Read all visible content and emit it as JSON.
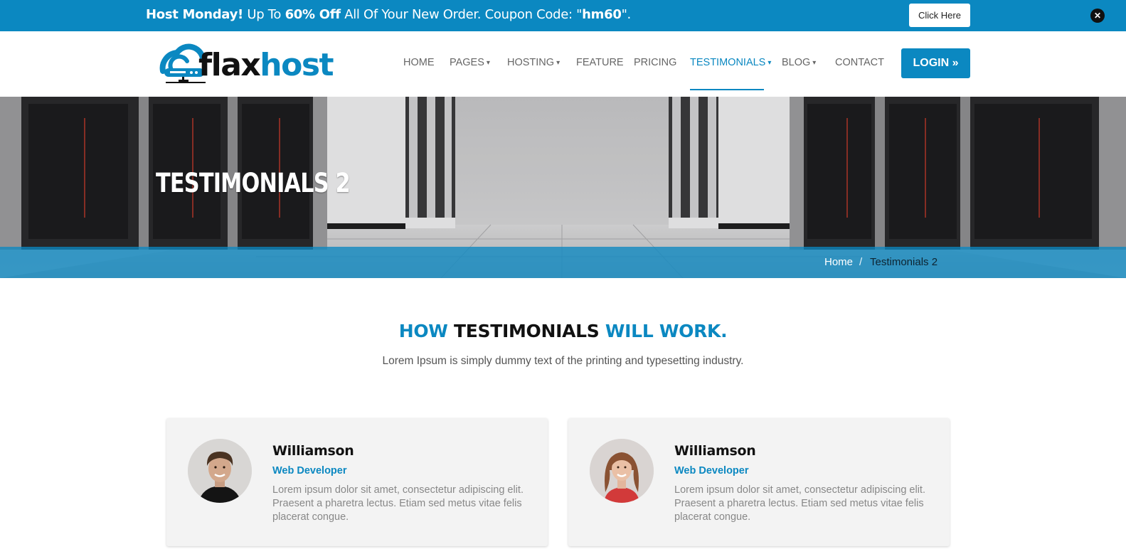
{
  "promo": {
    "lead": "Host Monday!",
    "text1": " Up To ",
    "discount": "60% Off",
    "text2": " All Of Your New Order. Coupon Code: \"",
    "code": "hm60",
    "text3": "\".",
    "button_label": "Click Here",
    "close_icon": "close-icon"
  },
  "logo": {
    "part1": "flax",
    "part2": "host",
    "icon": "cloud-server-icon"
  },
  "nav": {
    "items": [
      {
        "label": "HOME",
        "dropdown": false
      },
      {
        "label": "PAGES",
        "dropdown": true
      },
      {
        "label": "HOSTING",
        "dropdown": true
      },
      {
        "label": "FEATURE",
        "dropdown": false
      },
      {
        "label": "PRICING",
        "dropdown": false
      },
      {
        "label": "TESTIMONIALS",
        "dropdown": true,
        "active": true
      },
      {
        "label": "BLOG",
        "dropdown": true
      },
      {
        "label": "CONTACT",
        "dropdown": false
      }
    ],
    "login_label": "LOGIN",
    "login_icon": "double-chevron-right-icon"
  },
  "hero": {
    "title": "TESTIMONIALS 2",
    "breadcrumb": {
      "home": "Home",
      "separator": "/",
      "current": "Testimonials 2"
    }
  },
  "section": {
    "title_part1": "HOW",
    "title_part2": "TESTIMONIALS",
    "title_part3": "WILL WORK.",
    "subtitle": "Lorem Ipsum is simply dummy text of the printing and typesetting industry."
  },
  "testimonials": [
    {
      "name": "Williamson",
      "role": "Web Developer",
      "text": "Lorem ipsum dolor sit amet, consectetur adipiscing elit. Praesent a pharetra lectus. Etiam sed metus vitae felis placerat congue."
    },
    {
      "name": "Williamson",
      "role": "Web Developer",
      "text": "Lorem ipsum dolor sit amet, consectetur adipiscing elit. Praesent a pharetra lectus. Etiam sed metus vitae felis placerat congue."
    }
  ],
  "colors": {
    "brand": "#0b88c1",
    "dark": "#111111",
    "card_bg": "#f3f3f3"
  }
}
